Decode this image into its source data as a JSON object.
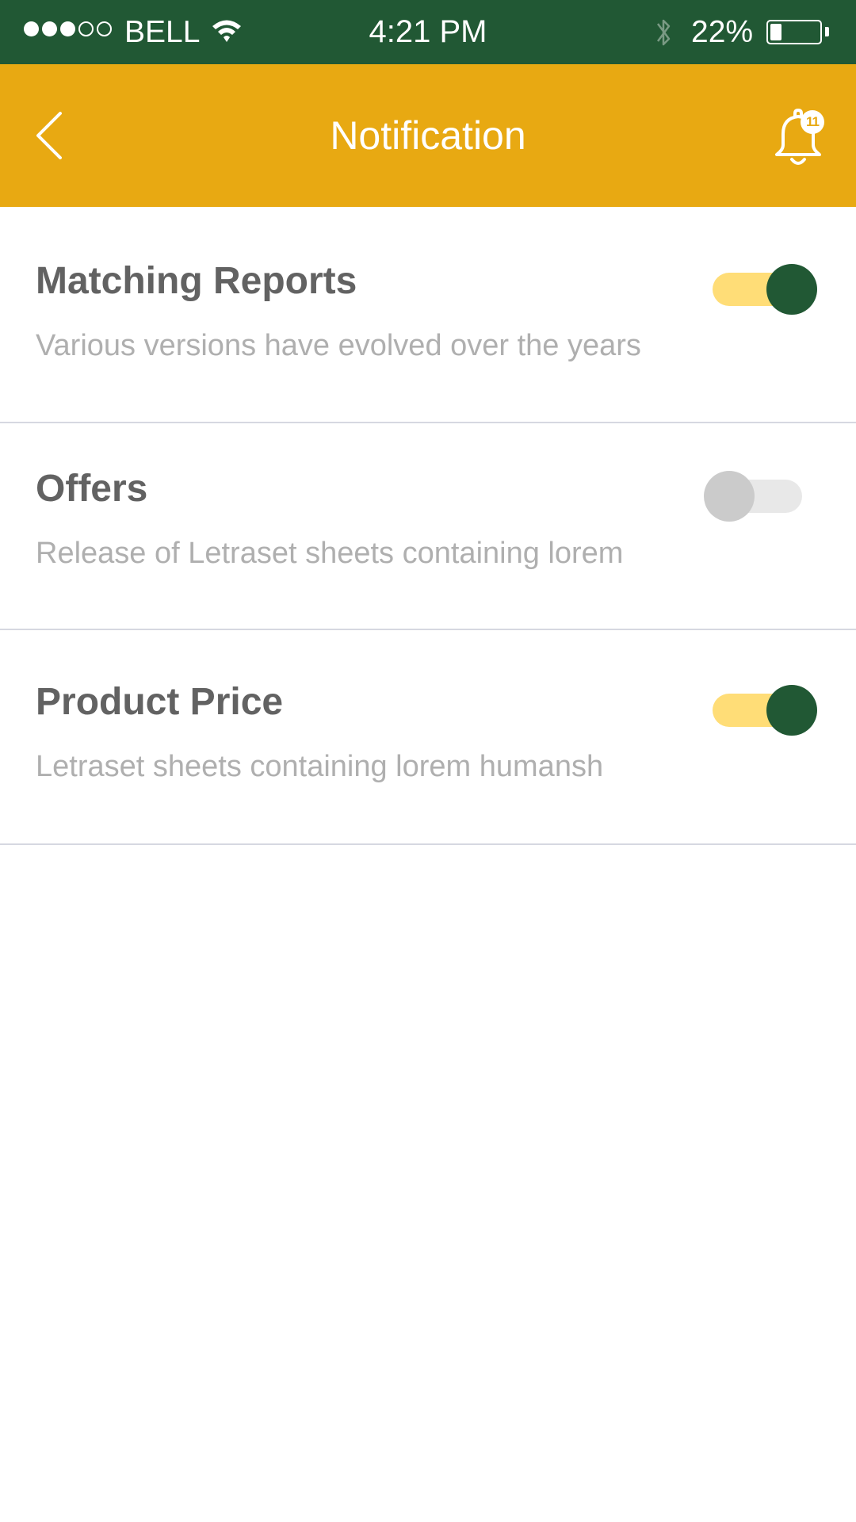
{
  "status_bar": {
    "signal_filled": 3,
    "signal_total": 5,
    "carrier": "BELL",
    "time": "4:21 PM",
    "battery_percent": "22%",
    "battery_level": 0.22,
    "icons": [
      "signal-dots-icon",
      "wifi-icon",
      "bluetooth-icon",
      "battery-icon"
    ]
  },
  "header": {
    "title": "Notification",
    "back_icon": "chevron-left-icon",
    "bell_icon": "bell-icon",
    "badge_count": "11"
  },
  "settings": [
    {
      "label": "Matching Reports",
      "description": "Various versions have evolved over the years",
      "enabled": true
    },
    {
      "label": "Offers",
      "description": "Release of Letraset sheets containing lorem",
      "enabled": false
    },
    {
      "label": "Product Price",
      "description": "Letraset sheets containing lorem humansh",
      "enabled": true
    }
  ],
  "colors": {
    "status_bar": "#215834",
    "app_bar": "#e8a912",
    "toggle_on_knob": "#215834",
    "toggle_on_track": "#ffdd77",
    "toggle_off_knob": "#cbcbcb",
    "toggle_off_track": "#e8e8e8",
    "label_text": "#626262",
    "description_text": "#afafaf",
    "divider": "#d6d8e1"
  }
}
